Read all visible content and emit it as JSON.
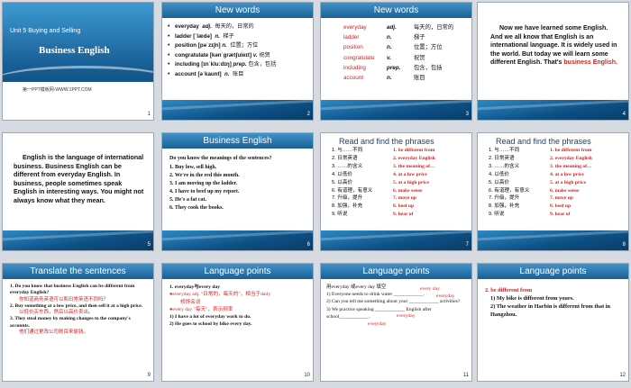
{
  "slides": {
    "s1": {
      "unit": "Unit 5 Buying and Selling",
      "title": "Business English",
      "site": "第一PPT模板网-WWW.1PPT.COM",
      "num": "1"
    },
    "s2": {
      "header": "New words",
      "num": "2",
      "items": [
        {
          "word": "everyday",
          "pos": "adj.",
          "meaning": "每天的，日常的"
        },
        {
          "word": "ladder [ˈlædə]",
          "pos": "n.",
          "meaning": "梯子"
        },
        {
          "word": "position [pəˈzɪʃn]",
          "pos": "n.",
          "meaning": "位置；方位"
        },
        {
          "word": "congratulate [kənˈɡrætʃuleɪt]",
          "pos": "v.",
          "meaning": "祝贺"
        },
        {
          "word": "including [ɪnˈkluːdɪŋ]",
          "pos": "prep.",
          "meaning": "包含，包括"
        },
        {
          "word": "account [əˈkaunt]",
          "pos": "n.",
          "meaning": "账目"
        }
      ]
    },
    "s3": {
      "header": "New words",
      "num": "3",
      "items": [
        {
          "word": "everyday",
          "pos": "adj.",
          "meaning": "每天的，日常的"
        },
        {
          "word": "ladder",
          "pos": "n.",
          "meaning": "梯子"
        },
        {
          "word": "position",
          "pos": "n.",
          "meaning": "位置；方位"
        },
        {
          "word": "congratulate",
          "pos": "v.",
          "meaning": "祝贺"
        },
        {
          "word": "including",
          "pos": "prep.",
          "meaning": "包含，包括"
        },
        {
          "word": "account",
          "pos": "n.",
          "meaning": "账目"
        }
      ]
    },
    "s4": {
      "num": "4",
      "text": "Now we have learned some English.  And we all know that English is an international language. It is widely used in the world. But today we will learn some different English. That's",
      "highlight": "business English."
    },
    "s5": {
      "num": "5",
      "text": "English is the language of international business. Business English can be different from everyday English. In business, people sometimes  speak English in interesting ways.  You might not always  know what they mean."
    },
    "s6": {
      "header": "Business English",
      "num": "6",
      "question": "Do you know the meanings of the sentences?",
      "lines": [
        "1. Buy low, sell high.",
        "2. We're in the red this month.",
        "3. I am moving up the ladder.",
        "4. I have to   beef up my report.",
        "5. He's a fat cat.",
        "6. They cook the books."
      ]
    },
    "s7": {
      "header": "Read and find the phrases",
      "num": "7",
      "left": [
        "1. 与……不同",
        "2. 日常英语",
        "3. ……的含义",
        "4. 以低价",
        "5. 以高价",
        "6. 有道理，有意义",
        "7. 升级，提升",
        "8. 加强，补充",
        "9. 听说"
      ],
      "right": [
        "1. be different from",
        "2. everyday English",
        "3. the meaning of…",
        "4. at a low price",
        "5. at a high price",
        "6. make sense",
        "7. move up",
        "8. beef up",
        "9. hear of"
      ]
    },
    "s8": {
      "header": "Read and find the phrases",
      "num": "8",
      "left": [
        "1. 与……不同",
        "2. 日常英语",
        "3. ……的含义",
        "4. 以低价",
        "5. 以高价",
        "6. 有道理，有意义",
        "7. 升级，提升",
        "8. 加强，补充",
        "9. 听说"
      ],
      "right": [
        "1. be different from",
        "2. everyday English",
        "3. the meaning of…",
        "4. at a low price",
        "5. at a high price",
        "6. make sense",
        "7. move up",
        "8. beef up",
        "9. hear of"
      ]
    },
    "s9": {
      "header": "Translate the sentences",
      "num": "9",
      "q1": "1. Do you know that business English can be different from everyday English?",
      "a1": "你知道商务英语可以和日常英语不同吗？",
      "q2": "2. Buy something at a low price, and then sell it at a high price.",
      "a2": "以低价买东西，然后以高价卖出。",
      "q3": "3. They steal money by making changes to the company's accounts.",
      "a3": "他们通过更改公司账目来偷钱。"
    },
    "s10": {
      "header": "Language points",
      "num": "10",
      "l1": "1. everyday与every day",
      "l2": "●everyday adj. \"日常的，每天的\"，相当于daily",
      "l3": "修饰名词",
      "l4": "●every day \"每天\"，表示频率",
      "l5": "1) I have a lot of everyday work to do.",
      "l6": "2) He goes to school by bike every day."
    },
    "s11": {
      "header": "Language points",
      "num": "11",
      "intro": "用everyday 或every day 填空",
      "a1": "every day",
      "a2": "everyday",
      "a3": "everyday",
      "a4": "everyday",
      "q1": "1) Everyone needs to drink water ____________.",
      "q2": "2) Can you tell me something about your ____________ activities?",
      "q3": "3) We practice speaking ____________ English after school____________."
    },
    "s12": {
      "header": "Language points",
      "num": "12",
      "l1": "2. be different from",
      "l2": "1)  My bike is different from yours.",
      "l3": "2)  The weather in Harbin  is different from that in Hangzhou."
    }
  }
}
